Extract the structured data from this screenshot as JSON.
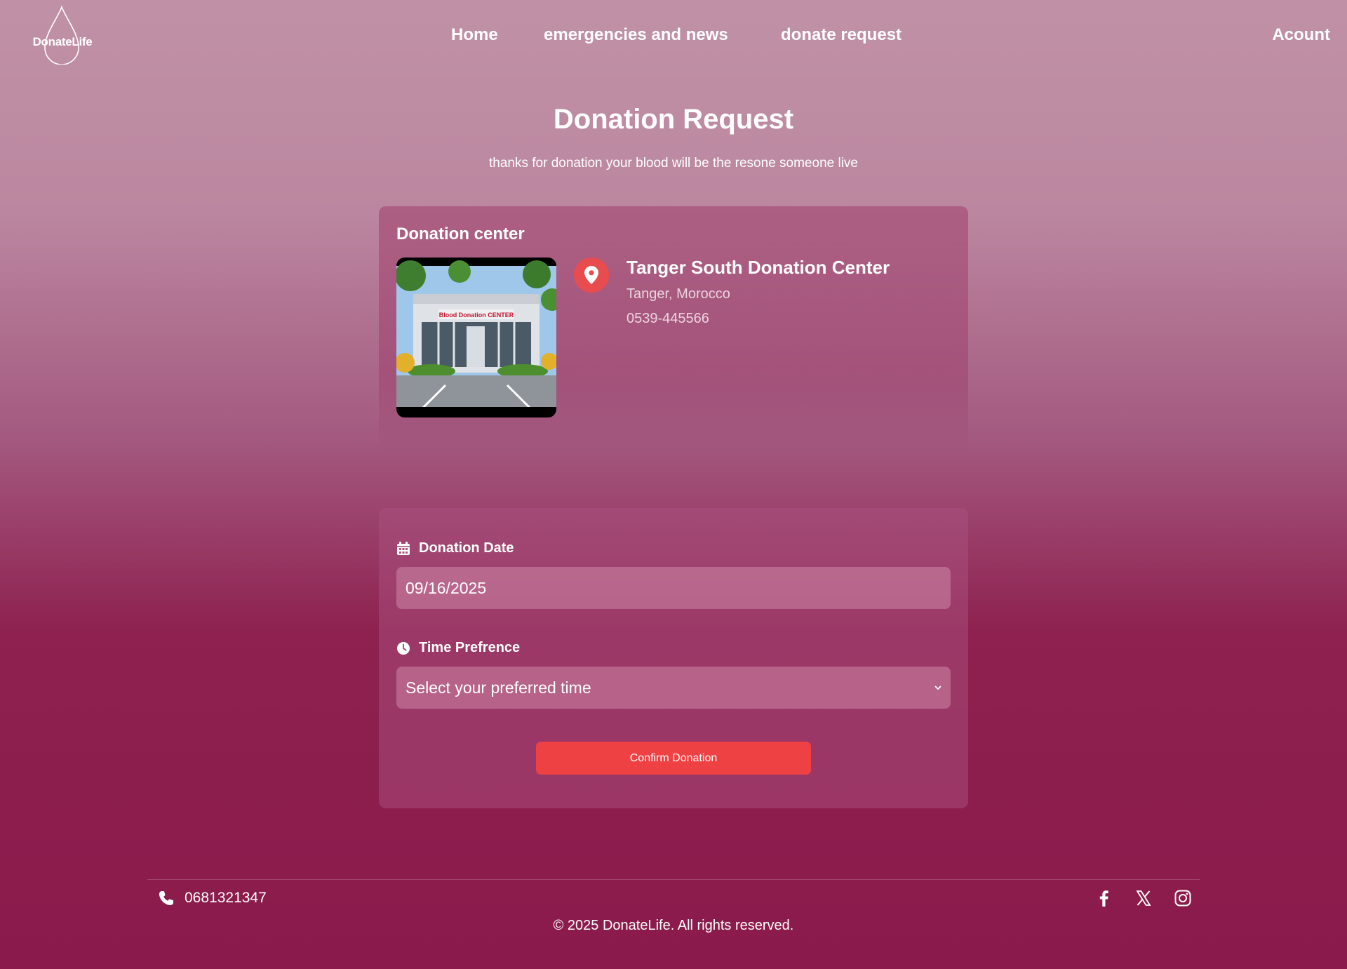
{
  "header": {
    "logo_text": "DonateLife",
    "nav": {
      "home": "Home",
      "emergencies": "emergencies and news",
      "donate_request": "donate request",
      "account": "Acount"
    }
  },
  "page": {
    "title": "Donation Request",
    "subtitle": "thanks for donation your blood will be the resone someone live"
  },
  "center": {
    "heading": "Donation center",
    "name": "Tanger South Donation Center",
    "city": "Tanger, Morocco",
    "phone": "0539-445566",
    "photo_sign": "Blood Donation CENTER"
  },
  "form": {
    "date_label": "Donation Date",
    "date_value": "09/16/2025",
    "time_label": "Time Prefrence",
    "time_placeholder": "Select your preferred time",
    "confirm_label": "Confirm Donation"
  },
  "footer": {
    "phone": "0681321347",
    "copyright": "© 2025 DonateLife. All rights reserved.",
    "socials": [
      "facebook-icon",
      "x-icon",
      "instagram-icon"
    ]
  },
  "colors": {
    "accent": "#ee4144",
    "pin": "#e94c4f",
    "bg_top": "#c091a6",
    "bg_bottom": "#8a1a4b"
  }
}
